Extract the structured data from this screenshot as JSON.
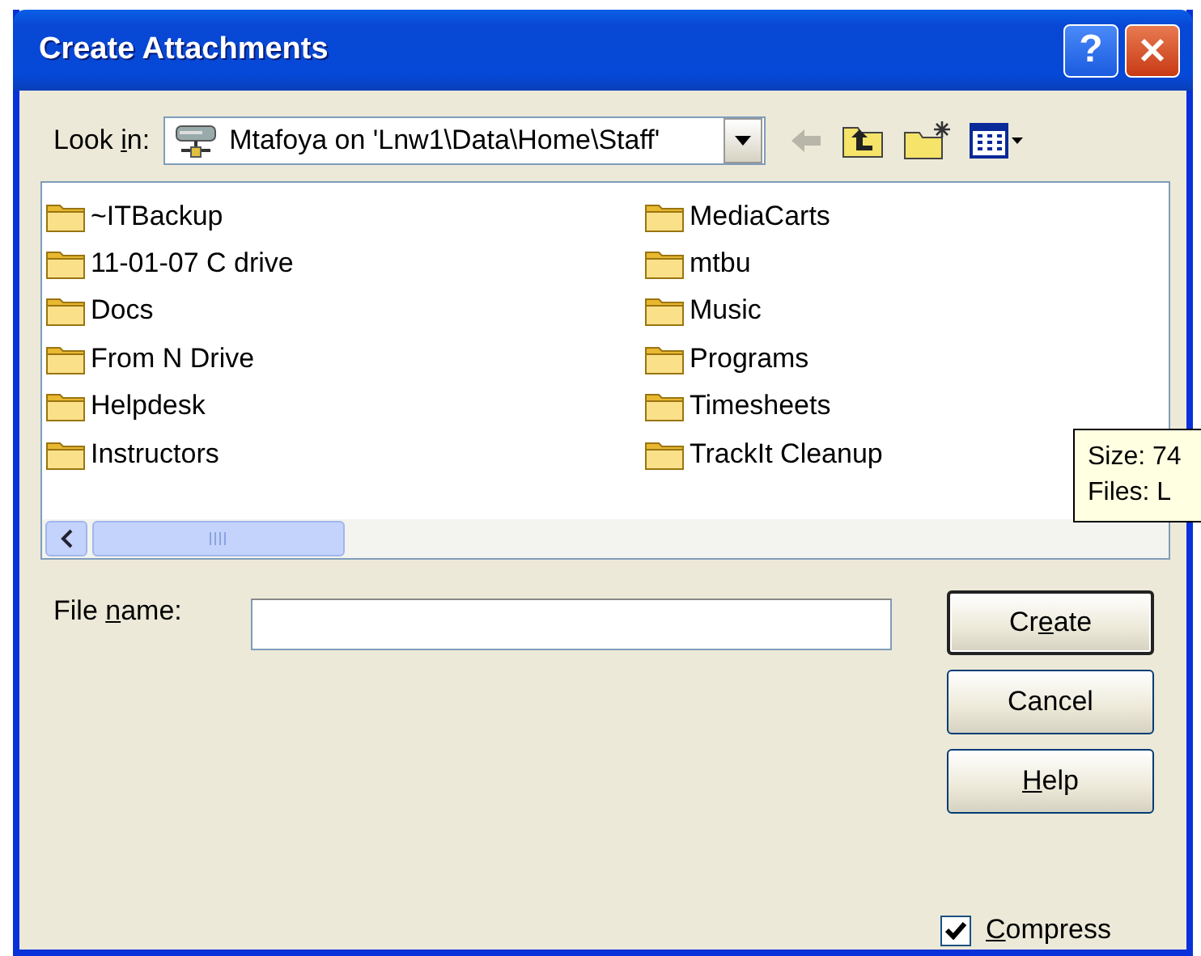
{
  "window": {
    "title": "Create Attachments",
    "buttons": [
      {
        "kind": "help",
        "glyph": "?"
      },
      {
        "kind": "close"
      }
    ]
  },
  "look_in": {
    "label": [
      {
        "text": "Look ",
        "underline": false
      },
      {
        "text": "i",
        "underline": true
      },
      {
        "text": "n:",
        "underline": false
      }
    ],
    "value": "Mtafoya on 'Lnw1\\Data\\Home\\Staff'"
  },
  "toolbar": [
    {
      "kind": "back",
      "disabled": true
    },
    {
      "kind": "up",
      "disabled": false
    },
    {
      "kind": "new-folder",
      "disabled": false
    },
    {
      "kind": "views",
      "disabled": false
    }
  ],
  "folders": [
    {
      "name": "~ITBackup"
    },
    {
      "name": "11-01-07 C drive"
    },
    {
      "name": "Docs"
    },
    {
      "name": "From N Drive"
    },
    {
      "name": "Helpdesk"
    },
    {
      "name": "Instructors"
    },
    {
      "name": "MediaCarts"
    },
    {
      "name": "mtbu"
    },
    {
      "name": "Music"
    },
    {
      "name": "Programs"
    },
    {
      "name": "Timesheets"
    },
    {
      "name": "TrackIt Cleanup"
    }
  ],
  "file_name": {
    "label": [
      {
        "text": "File ",
        "underline": false
      },
      {
        "text": "n",
        "underline": true
      },
      {
        "text": "ame:",
        "underline": false
      }
    ]
  },
  "buttons": [
    {
      "default": true,
      "label": [
        {
          "text": "Cr",
          "underline": false
        },
        {
          "text": "e",
          "underline": true
        },
        {
          "text": "ate",
          "underline": false
        }
      ]
    },
    {
      "default": false,
      "label": [
        {
          "text": "Cancel",
          "underline": false
        }
      ]
    },
    {
      "default": false,
      "label": [
        {
          "text": "H",
          "underline": true
        },
        {
          "text": "elp",
          "underline": false
        }
      ]
    }
  ],
  "compress": {
    "checked": true,
    "label": [
      {
        "text": "C",
        "underline": true
      },
      {
        "text": "ompress",
        "underline": false
      }
    ]
  },
  "tooltip": {
    "lines": [
      "Size: 74",
      "Files: L"
    ]
  }
}
